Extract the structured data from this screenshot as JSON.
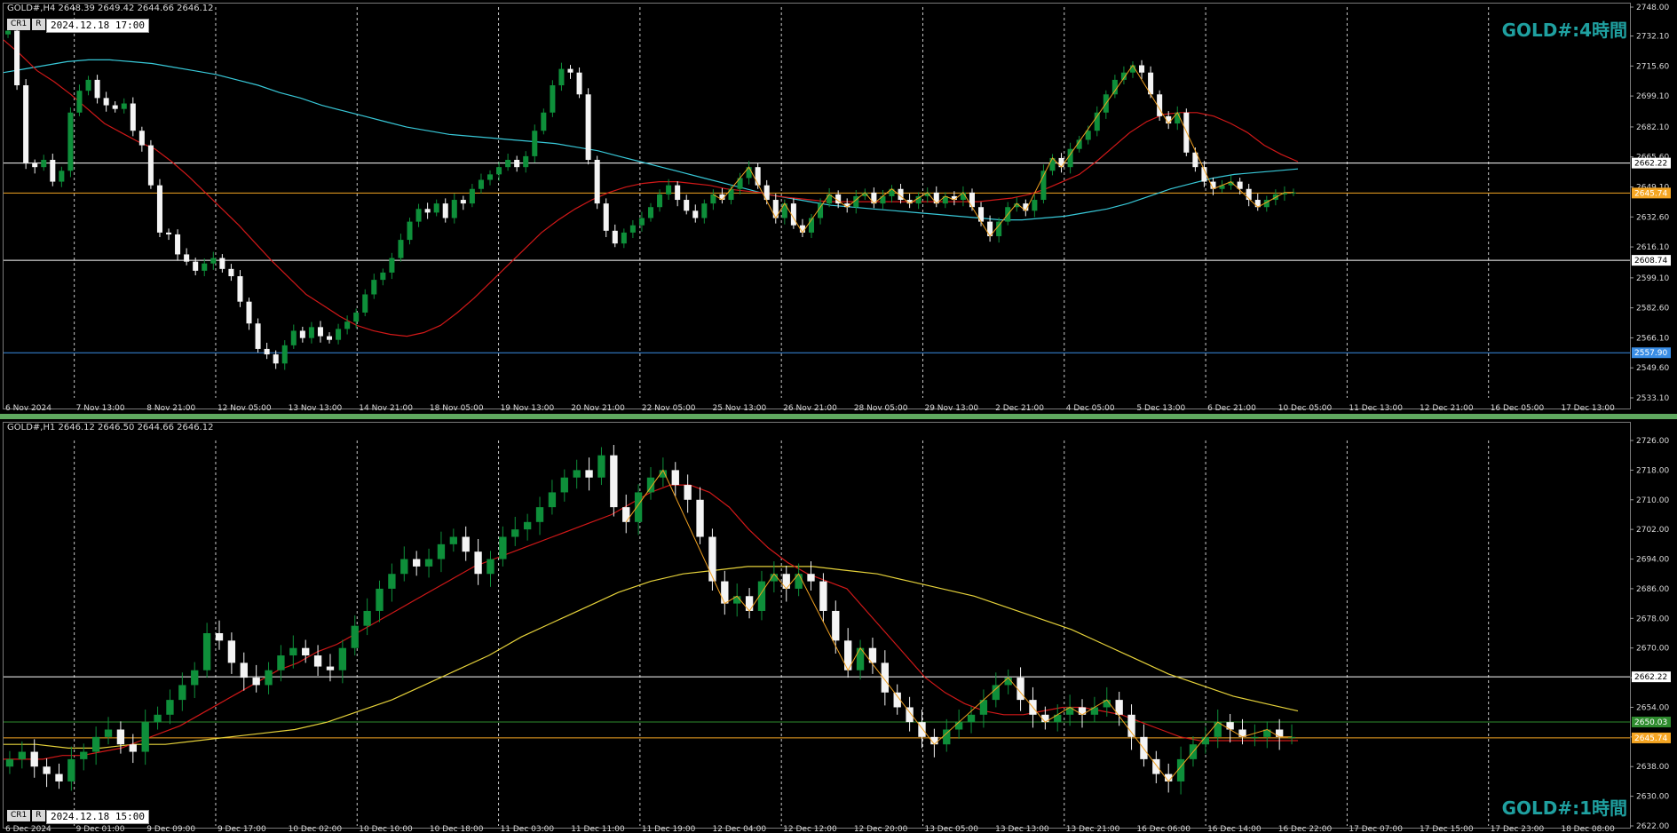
{
  "chart_data": [
    {
      "type": "candlestick",
      "symbol_line": "GOLD#,H4  2648.39 2649.42 2644.66 2646.12",
      "buttons": [
        "CR1",
        "R"
      ],
      "datetime": "2024.12.18 17:00",
      "watermark": "GOLD#:4時間",
      "ylim": [
        2533.1,
        2748.0
      ],
      "y_ticks": [
        2748.0,
        2732.1,
        2715.6,
        2699.1,
        2682.1,
        2665.6,
        2649.1,
        2632.6,
        2616.1,
        2599.1,
        2582.6,
        2566.1,
        2549.6,
        2533.1
      ],
      "x_labels": [
        "6 Nov 2024",
        "7 Nov 13:00",
        "8 Nov 21:00",
        "12 Nov 05:00",
        "13 Nov 13:00",
        "14 Nov 21:00",
        "18 Nov 05:00",
        "19 Nov 13:00",
        "20 Nov 21:00",
        "22 Nov 05:00",
        "25 Nov 13:00",
        "26 Nov 21:00",
        "28 Nov 05:00",
        "29 Nov 13:00",
        "2 Dec 21:00",
        "4 Dec 05:00",
        "5 Dec 13:00",
        "6 Dec 21:00",
        "10 Dec 05:00",
        "11 Dec 13:00",
        "12 Dec 21:00",
        "16 Dec 05:00",
        "17 Dec 13:00"
      ],
      "hlines": [
        {
          "value": 2662.22,
          "label": "2662.22",
          "color": "#ffffff"
        },
        {
          "value": 2645.74,
          "label": "2645.74",
          "color": "#f5a623"
        },
        {
          "value": 2608.74,
          "label": "2608.74",
          "color": "#ffffff"
        },
        {
          "value": 2557.9,
          "label": "2557.90",
          "color": "#3a8ee6"
        }
      ],
      "closes": [
        2735,
        2705,
        2662,
        2660,
        2664,
        2652,
        2658,
        2690,
        2702,
        2708,
        2698,
        2694,
        2692,
        2695,
        2680,
        2672,
        2650,
        2624,
        2623,
        2612,
        2608,
        2603,
        2607,
        2610,
        2604,
        2600,
        2586,
        2574,
        2560,
        2557,
        2552,
        2562,
        2570,
        2566,
        2572,
        2567,
        2565,
        2571,
        2575,
        2580,
        2590,
        2598,
        2602,
        2610,
        2620,
        2630,
        2637,
        2635,
        2640,
        2632,
        2642,
        2640,
        2648,
        2653,
        2656,
        2660,
        2664,
        2660,
        2666,
        2680,
        2690,
        2705,
        2714,
        2712,
        2700,
        2664,
        2640,
        2625,
        2618,
        2624,
        2628,
        2632,
        2638,
        2645,
        2650,
        2642,
        2636,
        2632,
        2640,
        2645,
        2642,
        2648,
        2654,
        2660,
        2650,
        2642,
        2632,
        2640,
        2628,
        2624,
        2632,
        2640,
        2645,
        2640,
        2638,
        2644,
        2646,
        2640,
        2644,
        2648,
        2642,
        2640,
        2644,
        2646,
        2640,
        2644,
        2642,
        2646,
        2638,
        2630,
        2622,
        2630,
        2638,
        2640,
        2636,
        2642,
        2658,
        2665,
        2660,
        2670,
        2675,
        2680,
        2690,
        2700,
        2708,
        2712,
        2716,
        2712,
        2700,
        2688,
        2684,
        2690,
        2668,
        2660,
        2652,
        2648,
        2650,
        2652,
        2648,
        2642,
        2638,
        2642,
        2645,
        2646,
        2646
      ],
      "ma_fast": [
        2730,
        2722,
        2713,
        2707,
        2700,
        2692,
        2684,
        2679,
        2674,
        2670,
        2663,
        2655,
        2646,
        2637,
        2628,
        2618,
        2608,
        2599,
        2590,
        2584,
        2578,
        2573,
        2570,
        2568,
        2567,
        2569,
        2573,
        2580,
        2588,
        2597,
        2606,
        2615,
        2624,
        2631,
        2637,
        2642,
        2646,
        2649,
        2651,
        2652,
        2652,
        2651,
        2650,
        2648,
        2647,
        2646,
        2644,
        2643,
        2642,
        2641,
        2641,
        2641,
        2641,
        2641,
        2641,
        2641,
        2641,
        2641,
        2641,
        2642,
        2643,
        2645,
        2648,
        2652,
        2656,
        2663,
        2671,
        2679,
        2685,
        2689,
        2690,
        2690,
        2688,
        2684,
        2679,
        2672,
        2667,
        2663
      ],
      "ma_slow": [
        2712,
        2714,
        2716,
        2718,
        2719,
        2719,
        2718,
        2717,
        2715,
        2713,
        2711,
        2708,
        2705,
        2701,
        2698,
        2694,
        2691,
        2688,
        2685,
        2682,
        2680,
        2678,
        2677,
        2676,
        2675,
        2674,
        2673,
        2671,
        2669,
        2666,
        2663,
        2660,
        2657,
        2654,
        2651,
        2648,
        2645,
        2643,
        2641,
        2639,
        2638,
        2637,
        2636,
        2635,
        2634,
        2633,
        2632,
        2631,
        2631,
        2632,
        2633,
        2635,
        2637,
        2640,
        2644,
        2648,
        2651,
        2654,
        2656,
        2657,
        2658,
        2659
      ]
    },
    {
      "type": "candlestick",
      "symbol_line": "GOLD#,H1  2646.12 2646.50 2644.66 2646.12",
      "buttons": [
        "CR1",
        "R"
      ],
      "datetime": "2024.12.18 15:00",
      "watermark": "GOLD#:1時間",
      "ylim": [
        2622.0,
        2726.0
      ],
      "y_ticks": [
        2726.0,
        2718.0,
        2710.0,
        2702.0,
        2694.0,
        2686.0,
        2678.0,
        2670.0,
        2662.0,
        2654.0,
        2646.0,
        2638.0,
        2630.0,
        2622.0
      ],
      "x_labels": [
        "6 Dec 2024",
        "9 Dec 01:00",
        "9 Dec 09:00",
        "9 Dec 17:00",
        "10 Dec 02:00",
        "10 Dec 10:00",
        "10 Dec 18:00",
        "11 Dec 03:00",
        "11 Dec 11:00",
        "11 Dec 19:00",
        "12 Dec 04:00",
        "12 Dec 12:00",
        "12 Dec 20:00",
        "13 Dec 05:00",
        "13 Dec 13:00",
        "13 Dec 21:00",
        "16 Dec 06:00",
        "16 Dec 14:00",
        "16 Dec 22:00",
        "17 Dec 07:00",
        "17 Dec 15:00",
        "17 Dec 23:00",
        "18 Dec 08:00"
      ],
      "hlines": [
        {
          "value": 2662.22,
          "label": "2662.22",
          "color": "#ffffff"
        },
        {
          "value": 2650.03,
          "label": "2650.03",
          "color": "#2e8b2e"
        },
        {
          "value": 2645.74,
          "label": "2645.74",
          "color": "#f5a623"
        }
      ],
      "closes": [
        2640,
        2642,
        2638,
        2636,
        2634,
        2640,
        2642,
        2646,
        2648,
        2644,
        2642,
        2650,
        2652,
        2656,
        2660,
        2664,
        2674,
        2672,
        2666,
        2662,
        2660,
        2664,
        2668,
        2670,
        2668,
        2665,
        2664,
        2670,
        2676,
        2680,
        2686,
        2690,
        2694,
        2692,
        2694,
        2698,
        2700,
        2696,
        2690,
        2694,
        2700,
        2702,
        2704,
        2708,
        2712,
        2716,
        2718,
        2716,
        2722,
        2708,
        2704,
        2712,
        2716,
        2718,
        2714,
        2710,
        2700,
        2688,
        2682,
        2684,
        2680,
        2688,
        2690,
        2686,
        2690,
        2688,
        2680,
        2672,
        2664,
        2670,
        2666,
        2658,
        2654,
        2650,
        2646,
        2644,
        2648,
        2650,
        2652,
        2656,
        2660,
        2662,
        2656,
        2652,
        2650,
        2652,
        2654,
        2652,
        2654,
        2656,
        2652,
        2646,
        2640,
        2636,
        2634,
        2640,
        2644,
        2646,
        2650,
        2648,
        2646,
        2646,
        2648,
        2646,
        2646
      ],
      "ma_fast": [
        2640,
        2640,
        2640,
        2641,
        2641,
        2642,
        2643,
        2645,
        2647,
        2649,
        2652,
        2655,
        2658,
        2661,
        2664,
        2666,
        2669,
        2671,
        2674,
        2677,
        2680,
        2683,
        2686,
        2689,
        2692,
        2694,
        2696,
        2698,
        2700,
        2702,
        2704,
        2706,
        2709,
        2712,
        2714,
        2714,
        2712,
        2708,
        2702,
        2697,
        2693,
        2690,
        2688,
        2686,
        2680,
        2674,
        2668,
        2662,
        2658,
        2655,
        2653,
        2652,
        2652,
        2653,
        2654,
        2654,
        2653,
        2652,
        2650,
        2648,
        2646,
        2645,
        2645,
        2645,
        2645,
        2645,
        2645
      ],
      "ma_slow": [
        2644,
        2644,
        2643,
        2643,
        2644,
        2644,
        2645,
        2646,
        2647,
        2648,
        2650,
        2653,
        2656,
        2660,
        2664,
        2668,
        2673,
        2677,
        2681,
        2685,
        2688,
        2690,
        2691,
        2692,
        2692,
        2692,
        2691,
        2690,
        2688,
        2686,
        2684,
        2681,
        2678,
        2675,
        2671,
        2667,
        2663,
        2660,
        2657,
        2655,
        2653
      ]
    }
  ]
}
